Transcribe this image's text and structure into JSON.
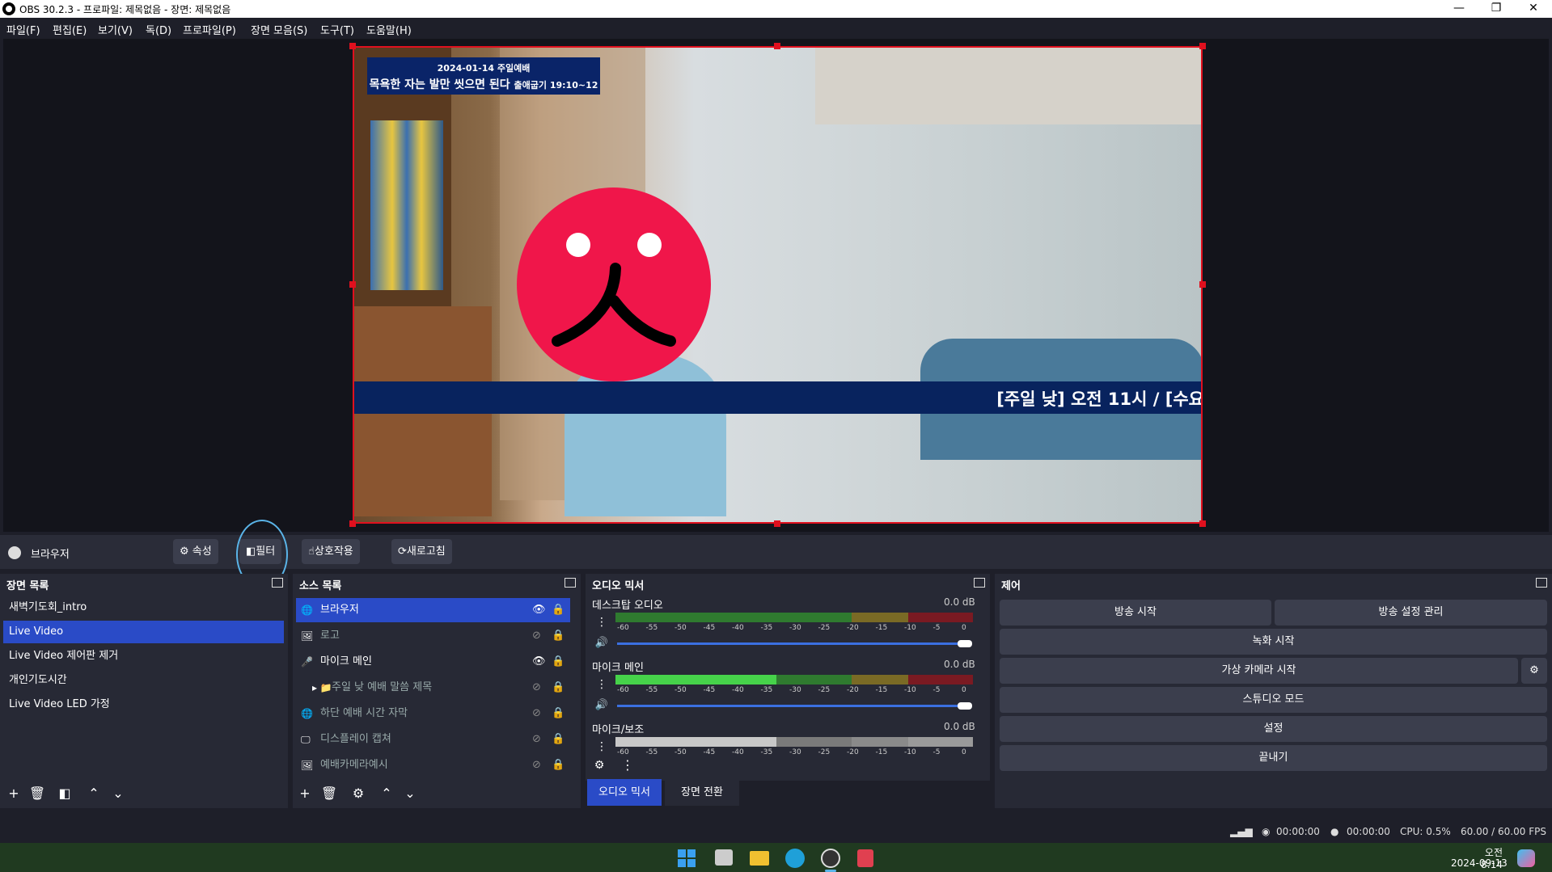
{
  "window": {
    "title": "OBS 30.2.3 - 프로파일: 제목없음 - 장면: 제목없음"
  },
  "menu": [
    "파일(F)",
    "편집(E)",
    "보기(V)",
    "독(D)",
    "프로파일(P)",
    "장면 모음(S)",
    "도구(T)",
    "도움말(H)"
  ],
  "overlay": {
    "date_line": "2024-01-14 주일예배",
    "sermon_title": "목욕한 자는 발만 씻으면 된다",
    "scripture": "출애굽기 19:10~12",
    "ticker": "[주일 낮] 오전 11시 / [수요"
  },
  "source_toolbar": {
    "selected_source": "브라우저",
    "properties": "속성",
    "filters": "필터",
    "interact": "상호작용",
    "refresh": "새로고침"
  },
  "scenes": {
    "title": "장면 목록",
    "items": [
      "새벽기도회_intro",
      "Live Video",
      "Live Video 제어판 제거",
      "개인기도시간",
      "Live Video LED 가정"
    ],
    "selected_index": 1
  },
  "sources": {
    "title": "소스 목록",
    "items": [
      {
        "name": "브라우저",
        "visible": true,
        "selected": true
      },
      {
        "name": "로고",
        "visible": false
      },
      {
        "name": "마이크 메인",
        "visible": true
      },
      {
        "name": "주일 낮 예배 말씀 제목",
        "visible": false,
        "group": true
      },
      {
        "name": "하단 예배 시간 자막",
        "visible": false
      },
      {
        "name": "디스플레이 캡쳐",
        "visible": false
      },
      {
        "name": "예배카메라예시",
        "visible": false
      }
    ]
  },
  "mixer": {
    "title": "오디오 믹서",
    "channels": [
      {
        "name": "데스크탑 오디오",
        "db": "0.0 dB",
        "level": 0.0,
        "muted": false
      },
      {
        "name": "마이크 메인",
        "db": "0.0 dB",
        "level": 0.45,
        "muted": false
      },
      {
        "name": "마이크/보조",
        "db": "0.0 dB",
        "level": 0.45,
        "muted": true
      }
    ],
    "scale": [
      "-60",
      "-55",
      "-50",
      "-45",
      "-40",
      "-35",
      "-30",
      "-25",
      "-20",
      "-15",
      "-10",
      "-5",
      "0"
    ],
    "tabs": [
      "오디오 믹서",
      "장면 전환"
    ]
  },
  "controls": {
    "title": "제어",
    "start_streaming": "방송 시작",
    "stream_settings": "방송 설정 관리",
    "start_recording": "녹화 시작",
    "virtual_camera": "가상 카메라 시작",
    "studio_mode": "스튜디오 모드",
    "settings": "설정",
    "exit": "끝내기"
  },
  "status": {
    "stream_time": "00:00:00",
    "rec_time": "00:00:00",
    "cpu": "CPU: 0.5%",
    "fps": "60.00 / 60.00 FPS"
  },
  "taskbar": {
    "time": "오전 8:14",
    "date": "2024-09-13"
  },
  "colors": {
    "accent": "#2a4bc7",
    "record_red": "#e0101e",
    "overlay_navy": "#0a2468"
  }
}
